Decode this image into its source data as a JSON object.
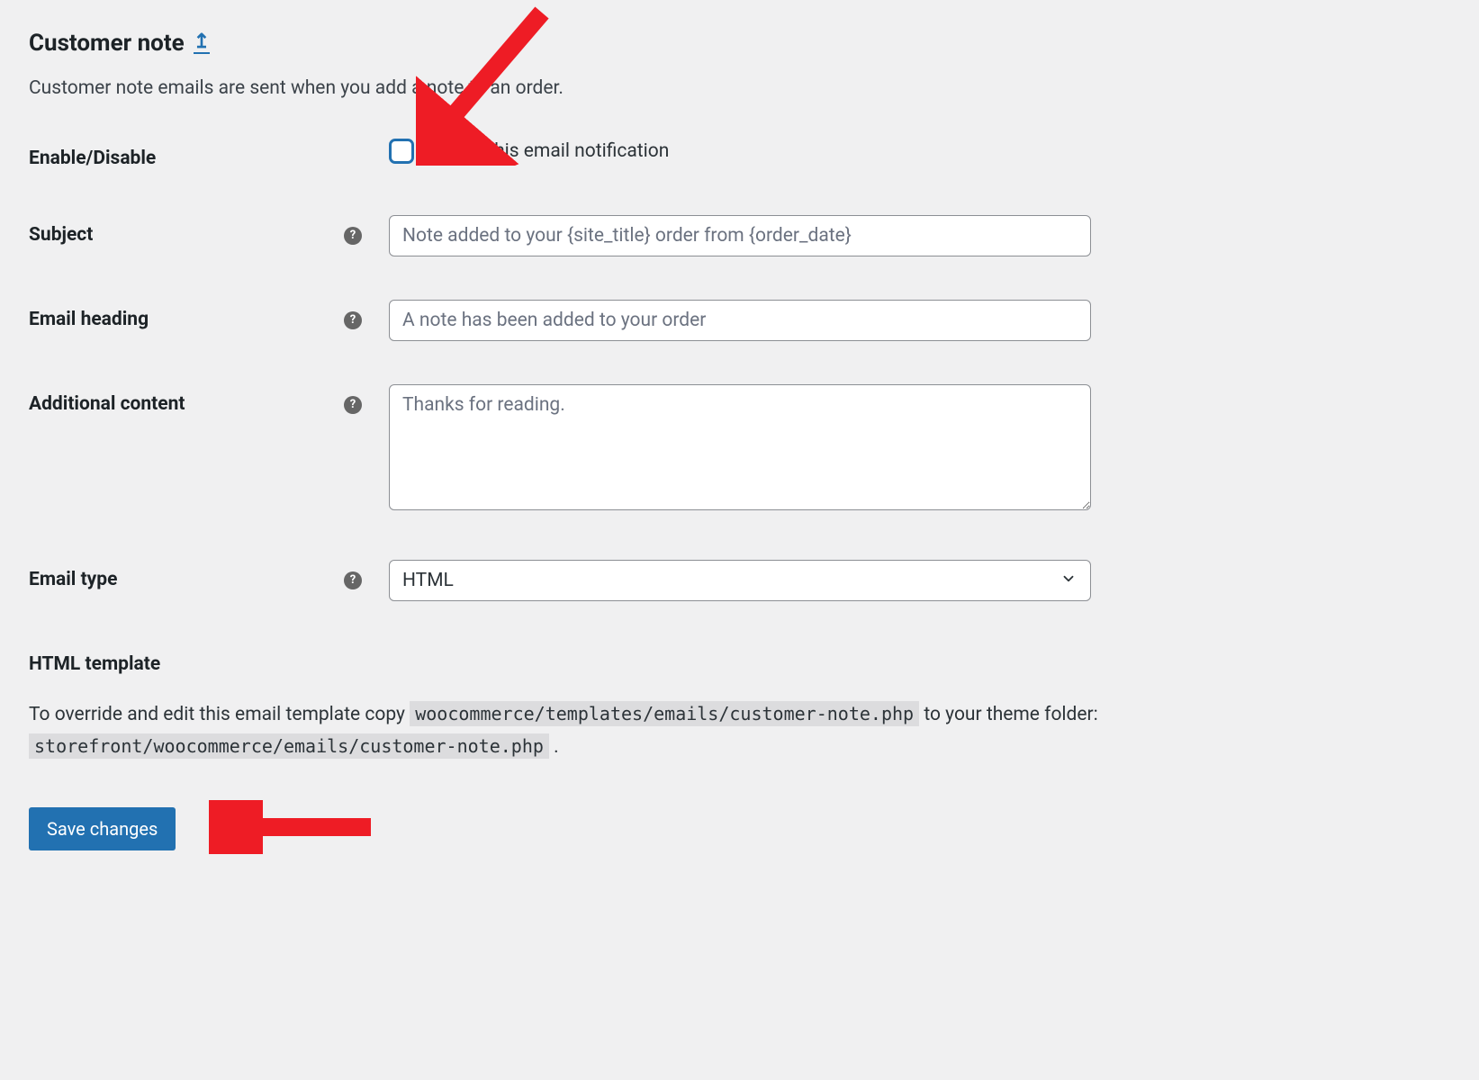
{
  "header": {
    "title": "Customer note",
    "back_icon": "↥"
  },
  "description": "Customer note emails are sent when you add a note to an order.",
  "fields": {
    "enable": {
      "label": "Enable/Disable",
      "checkbox_label": "Enable this email notification",
      "checked": false
    },
    "subject": {
      "label": "Subject",
      "placeholder": "Note added to your {site_title} order from {order_date}",
      "value": ""
    },
    "heading": {
      "label": "Email heading",
      "placeholder": "A note has been added to your order",
      "value": ""
    },
    "additional": {
      "label": "Additional content",
      "placeholder": "Thanks for reading.",
      "value": ""
    },
    "email_type": {
      "label": "Email type",
      "selected": "HTML"
    }
  },
  "template": {
    "heading": "HTML template",
    "text_before": "To override and edit this email template copy ",
    "path_source": "woocommerce/templates/emails/customer-note.php",
    "text_middle": " to your theme folder: ",
    "path_dest": "storefront/woocommerce/emails/customer-note.php",
    "text_after": " ."
  },
  "actions": {
    "save": "Save changes"
  },
  "help_glyph": "?"
}
